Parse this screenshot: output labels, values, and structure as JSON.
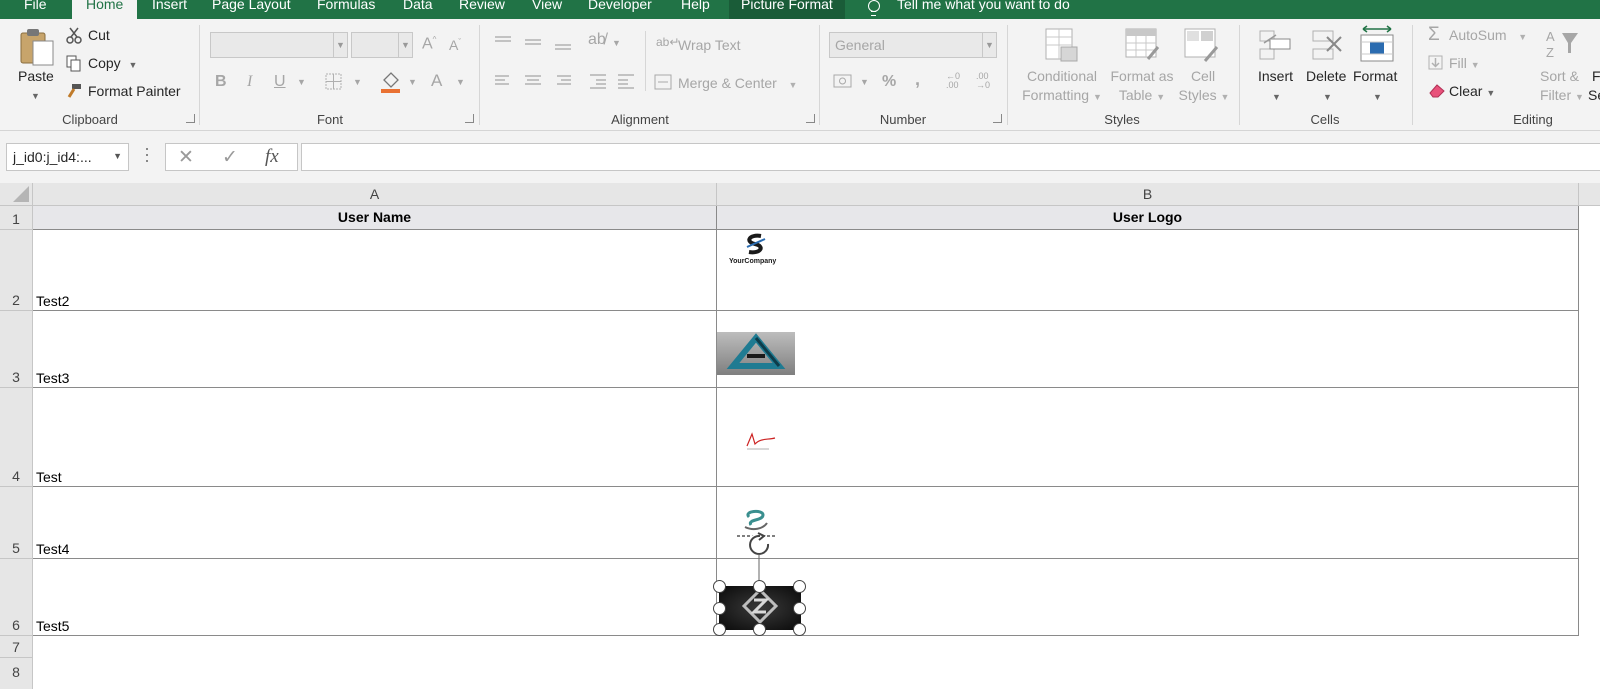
{
  "tabs": [
    "File",
    "Home",
    "Insert",
    "Page Layout",
    "Formulas",
    "Data",
    "Review",
    "View",
    "Developer",
    "Help",
    "Picture Format"
  ],
  "tell_me": "Tell me what you want to do",
  "ribbon": {
    "clipboard": {
      "label": "Clipboard",
      "paste": "Paste",
      "cut": "Cut",
      "copy": "Copy",
      "format_painter": "Format Painter"
    },
    "font": {
      "label": "Font",
      "bold": "B",
      "italic": "I",
      "underline": "U",
      "font_color": "A"
    },
    "alignment": {
      "label": "Alignment",
      "wrap_text": "Wrap Text",
      "merge_center": "Merge & Center"
    },
    "number": {
      "label": "Number",
      "format": "General",
      "percent": "%",
      "comma": ","
    },
    "styles": {
      "label": "Styles",
      "conditional_1": "Conditional",
      "conditional_2": "Formatting",
      "format_as_1": "Format as",
      "format_as_2": "Table",
      "cell_styles_1": "Cell",
      "cell_styles_2": "Styles"
    },
    "cells": {
      "label": "Cells",
      "insert": "Insert",
      "delete": "Delete",
      "format": "Format"
    },
    "editing": {
      "label": "Editing",
      "autosum": "AutoSum",
      "fill": "Fill",
      "clear": "Clear",
      "sort_1": "Sort &",
      "sort_2": "Filter",
      "find_1": "F",
      "find_2": "Se"
    }
  },
  "formula_bar": {
    "name_box": "j_id0:j_id4:...",
    "fx": "fx",
    "value": ""
  },
  "columns": [
    "A",
    "B"
  ],
  "rows": [
    {
      "num": "1",
      "a": "User Name",
      "b": "User Logo"
    },
    {
      "num": "2",
      "a": "Test2"
    },
    {
      "num": "3",
      "a": "Test3"
    },
    {
      "num": "4",
      "a": "Test"
    },
    {
      "num": "5",
      "a": "Test4"
    },
    {
      "num": "6",
      "a": "Test5"
    },
    {
      "num": "7",
      "a": ""
    },
    {
      "num": "8",
      "a": ""
    }
  ],
  "logos": {
    "logo1_text": "YourCompany"
  },
  "colors": {
    "excel_green": "#217346",
    "ribbon_bg": "#f3f3f3",
    "header_bg": "#e6e6e6",
    "fill_accent": "#e97132"
  }
}
